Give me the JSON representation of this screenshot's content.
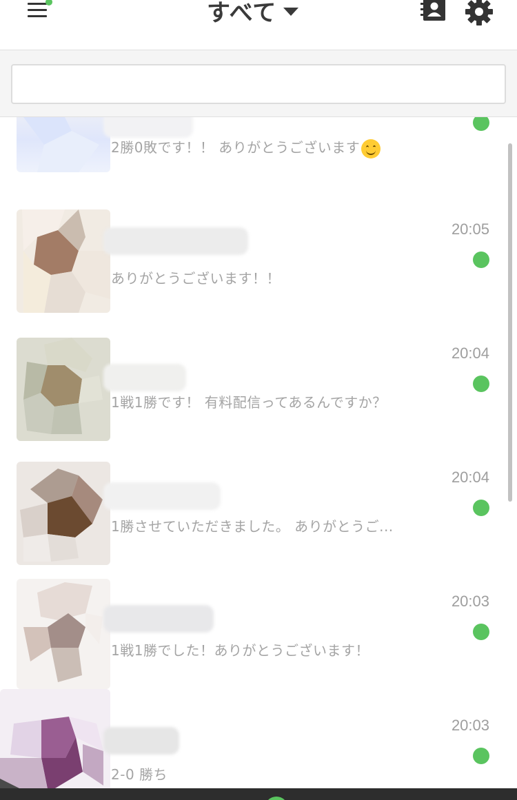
{
  "header": {
    "title": "すべて",
    "menu_icon": "hamburger-menu-icon",
    "contacts_icon": "contacts-icon",
    "settings_icon": "gear-icon",
    "notification_color": "#5ac45f"
  },
  "search": {
    "value": "",
    "placeholder": ""
  },
  "chats": [
    {
      "message": "2勝0敗です！！ ありがとうございます",
      "emoji": "smiling-face-emoji",
      "time": "",
      "unread": true
    },
    {
      "message": "ありがとうございます！！",
      "time": "20:05",
      "unread": true
    },
    {
      "message": "1戦1勝です！ 有料配信ってあるんですか？",
      "time": "20:04",
      "unread": true
    },
    {
      "message": "1勝させていただきました。 ありがとうご...",
      "time": "20:04",
      "unread": true
    },
    {
      "message": "1戦1勝でした！ありがとうございます！",
      "time": "20:03",
      "unread": true
    },
    {
      "message": "2-0 勝ち",
      "time": "20:03",
      "unread": true
    }
  ],
  "colors": {
    "accent": "#5ac45f",
    "message_text": "#a4a4a4",
    "time_text": "#9e9e9e",
    "bottom_bar": "#2d2d2d"
  }
}
